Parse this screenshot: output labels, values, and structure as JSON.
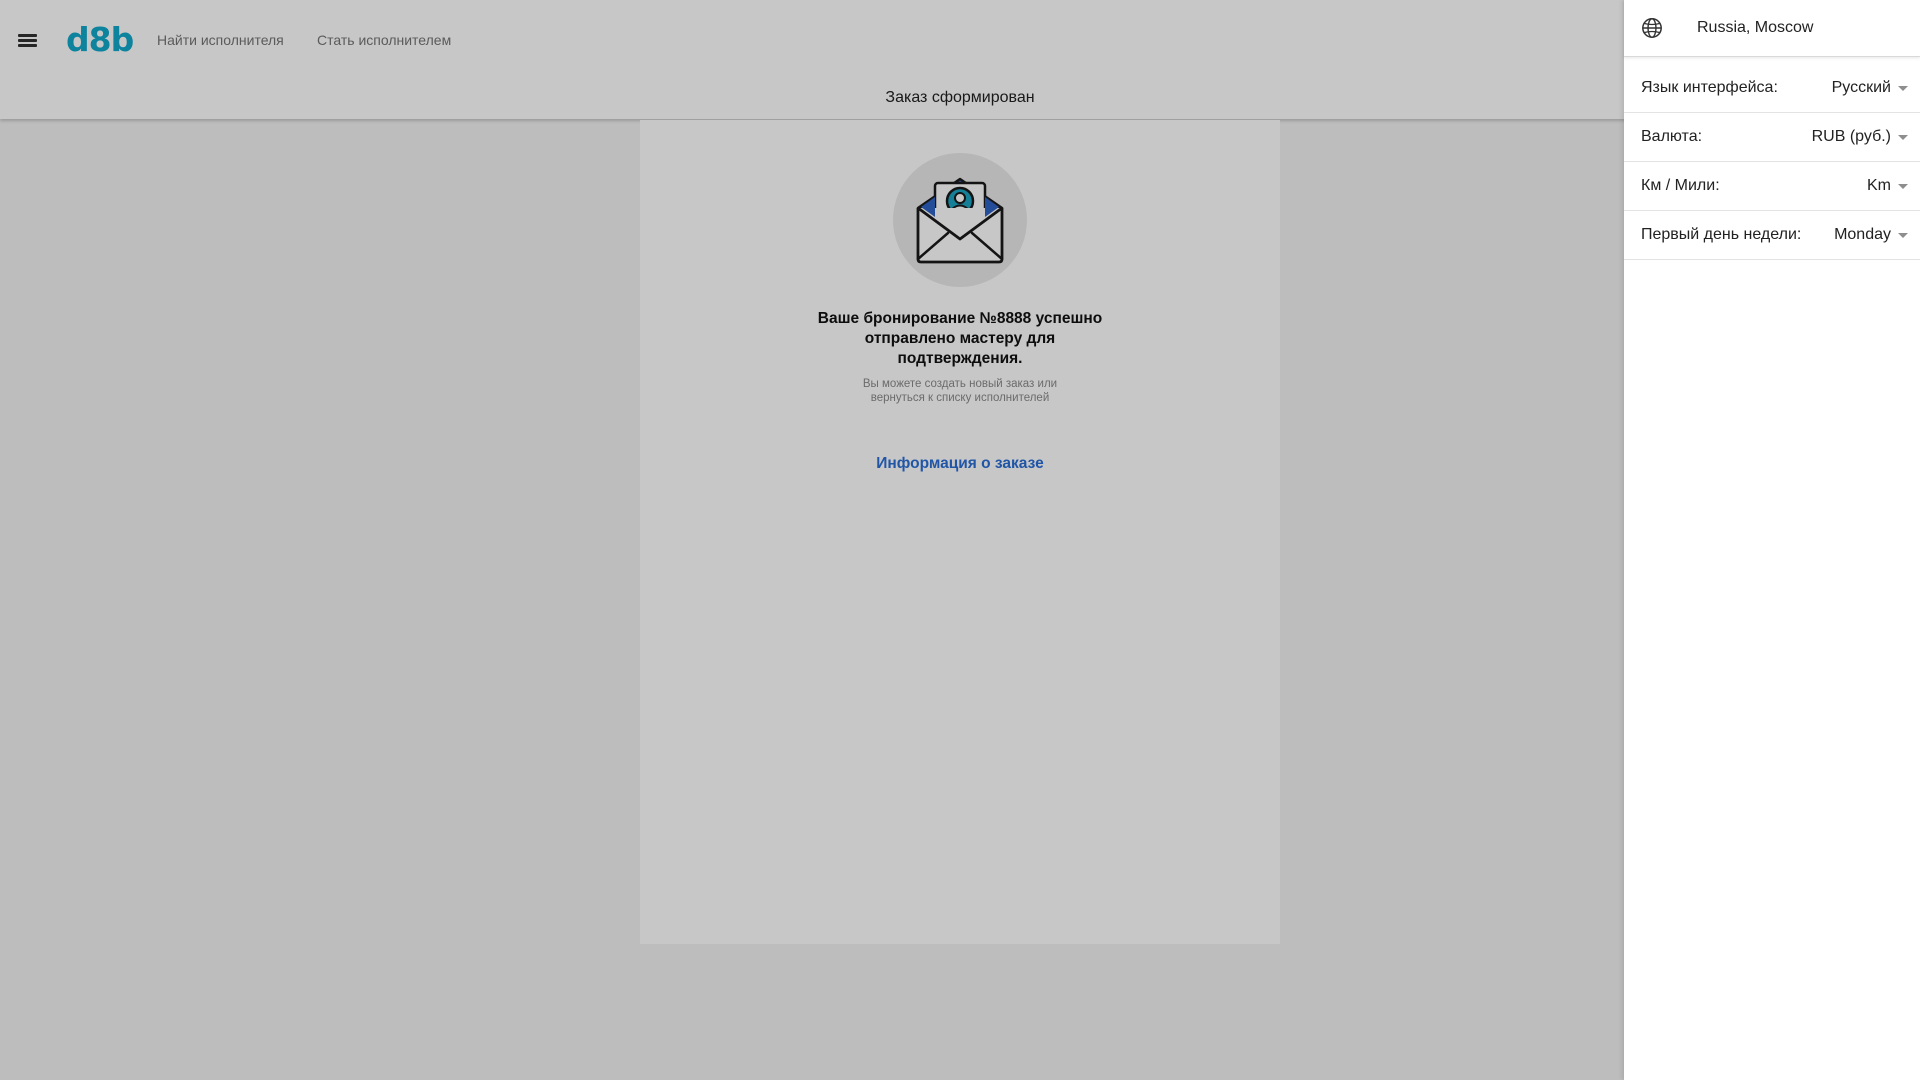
{
  "header": {
    "logo_text": "d8b",
    "nav": {
      "find_label": "Найти исполнителя",
      "become_label": "Стать исполнителем"
    },
    "page_title": "Заказ сформирован"
  },
  "confirmation": {
    "illustration_icon": "envelope-with-person-icon",
    "message": "Ваше бронирование №8888 успешно отправлено мастеру для подтверждения.",
    "hint": "Вы можете создать новый заказ или вернуться к списку исполнителей",
    "order_info_link": "Информация о заказе"
  },
  "drawer": {
    "location_icon": "globe-icon",
    "location": "Russia, Moscow",
    "settings": [
      {
        "label": "Язык интерфейса:",
        "value": "Русский"
      },
      {
        "label": "Валюта:",
        "value": "RUB (руб.)"
      },
      {
        "label": "Км / Мили:",
        "value": "Km"
      },
      {
        "label": "Первый день недели:",
        "value": "Monday"
      }
    ]
  },
  "colors": {
    "brand": "#13a8c9",
    "link": "#2b6fd6",
    "overlay": "rgba(0,0,0,0.22)"
  }
}
